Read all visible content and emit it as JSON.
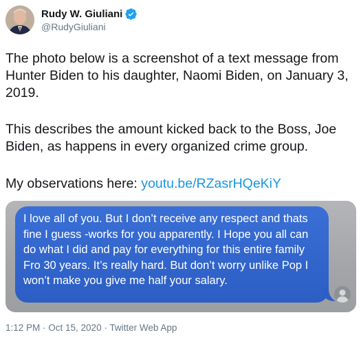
{
  "author": {
    "display_name": "Rudy W. Giuliani",
    "handle": "@RudyGiuliani",
    "verified": true
  },
  "tweet": {
    "paragraph_1": "The photo below is a screenshot of a text message from Hunter Biden to his daughter, Naomi Biden, on January 3, 2019.",
    "paragraph_2": "This describes the amount kicked back to the Boss, Joe Biden, as happens in every organized crime group.",
    "paragraph_3_prefix": "My observations here: ",
    "link_text": "youtu.be/RZasrHQeKiY"
  },
  "media": {
    "message_text": "I love all of you. But I don’t receive any respect and thats fine I guess -works for you apparently. I Hope you all can do what I did and pay for everything for this entire family Fro 30 years. It’s really hard. But don’t worry unlike Pop I won’t make you give me half your salary."
  },
  "footer": {
    "timestamp": "1:12 PM · Oct 15, 2020 · Twitter Web App"
  },
  "colors": {
    "link": "#1b95e0",
    "verified_badge": "#1da1f2",
    "bubble": "#2f63c9",
    "meta_text": "#657786"
  },
  "icons": [
    "verified-badge-icon",
    "person-silhouette-icon"
  ]
}
